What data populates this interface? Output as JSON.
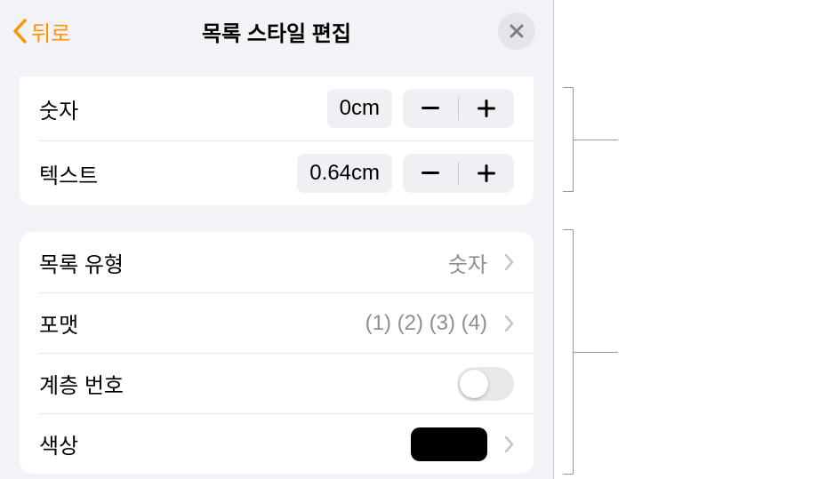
{
  "header": {
    "back_label": "뒤로",
    "title": "목록 스타일 편집"
  },
  "indent": {
    "number_label": "숫자",
    "number_value": "0cm",
    "text_label": "텍스트",
    "text_value": "0.64cm"
  },
  "list": {
    "type_label": "목록 유형",
    "type_value": "숫자",
    "format_label": "포맷",
    "format_value": "(1) (2) (3) (4)",
    "tiered_label": "계층 번호",
    "tiered_on": false,
    "color_label": "색상",
    "color_value": "#000000"
  }
}
